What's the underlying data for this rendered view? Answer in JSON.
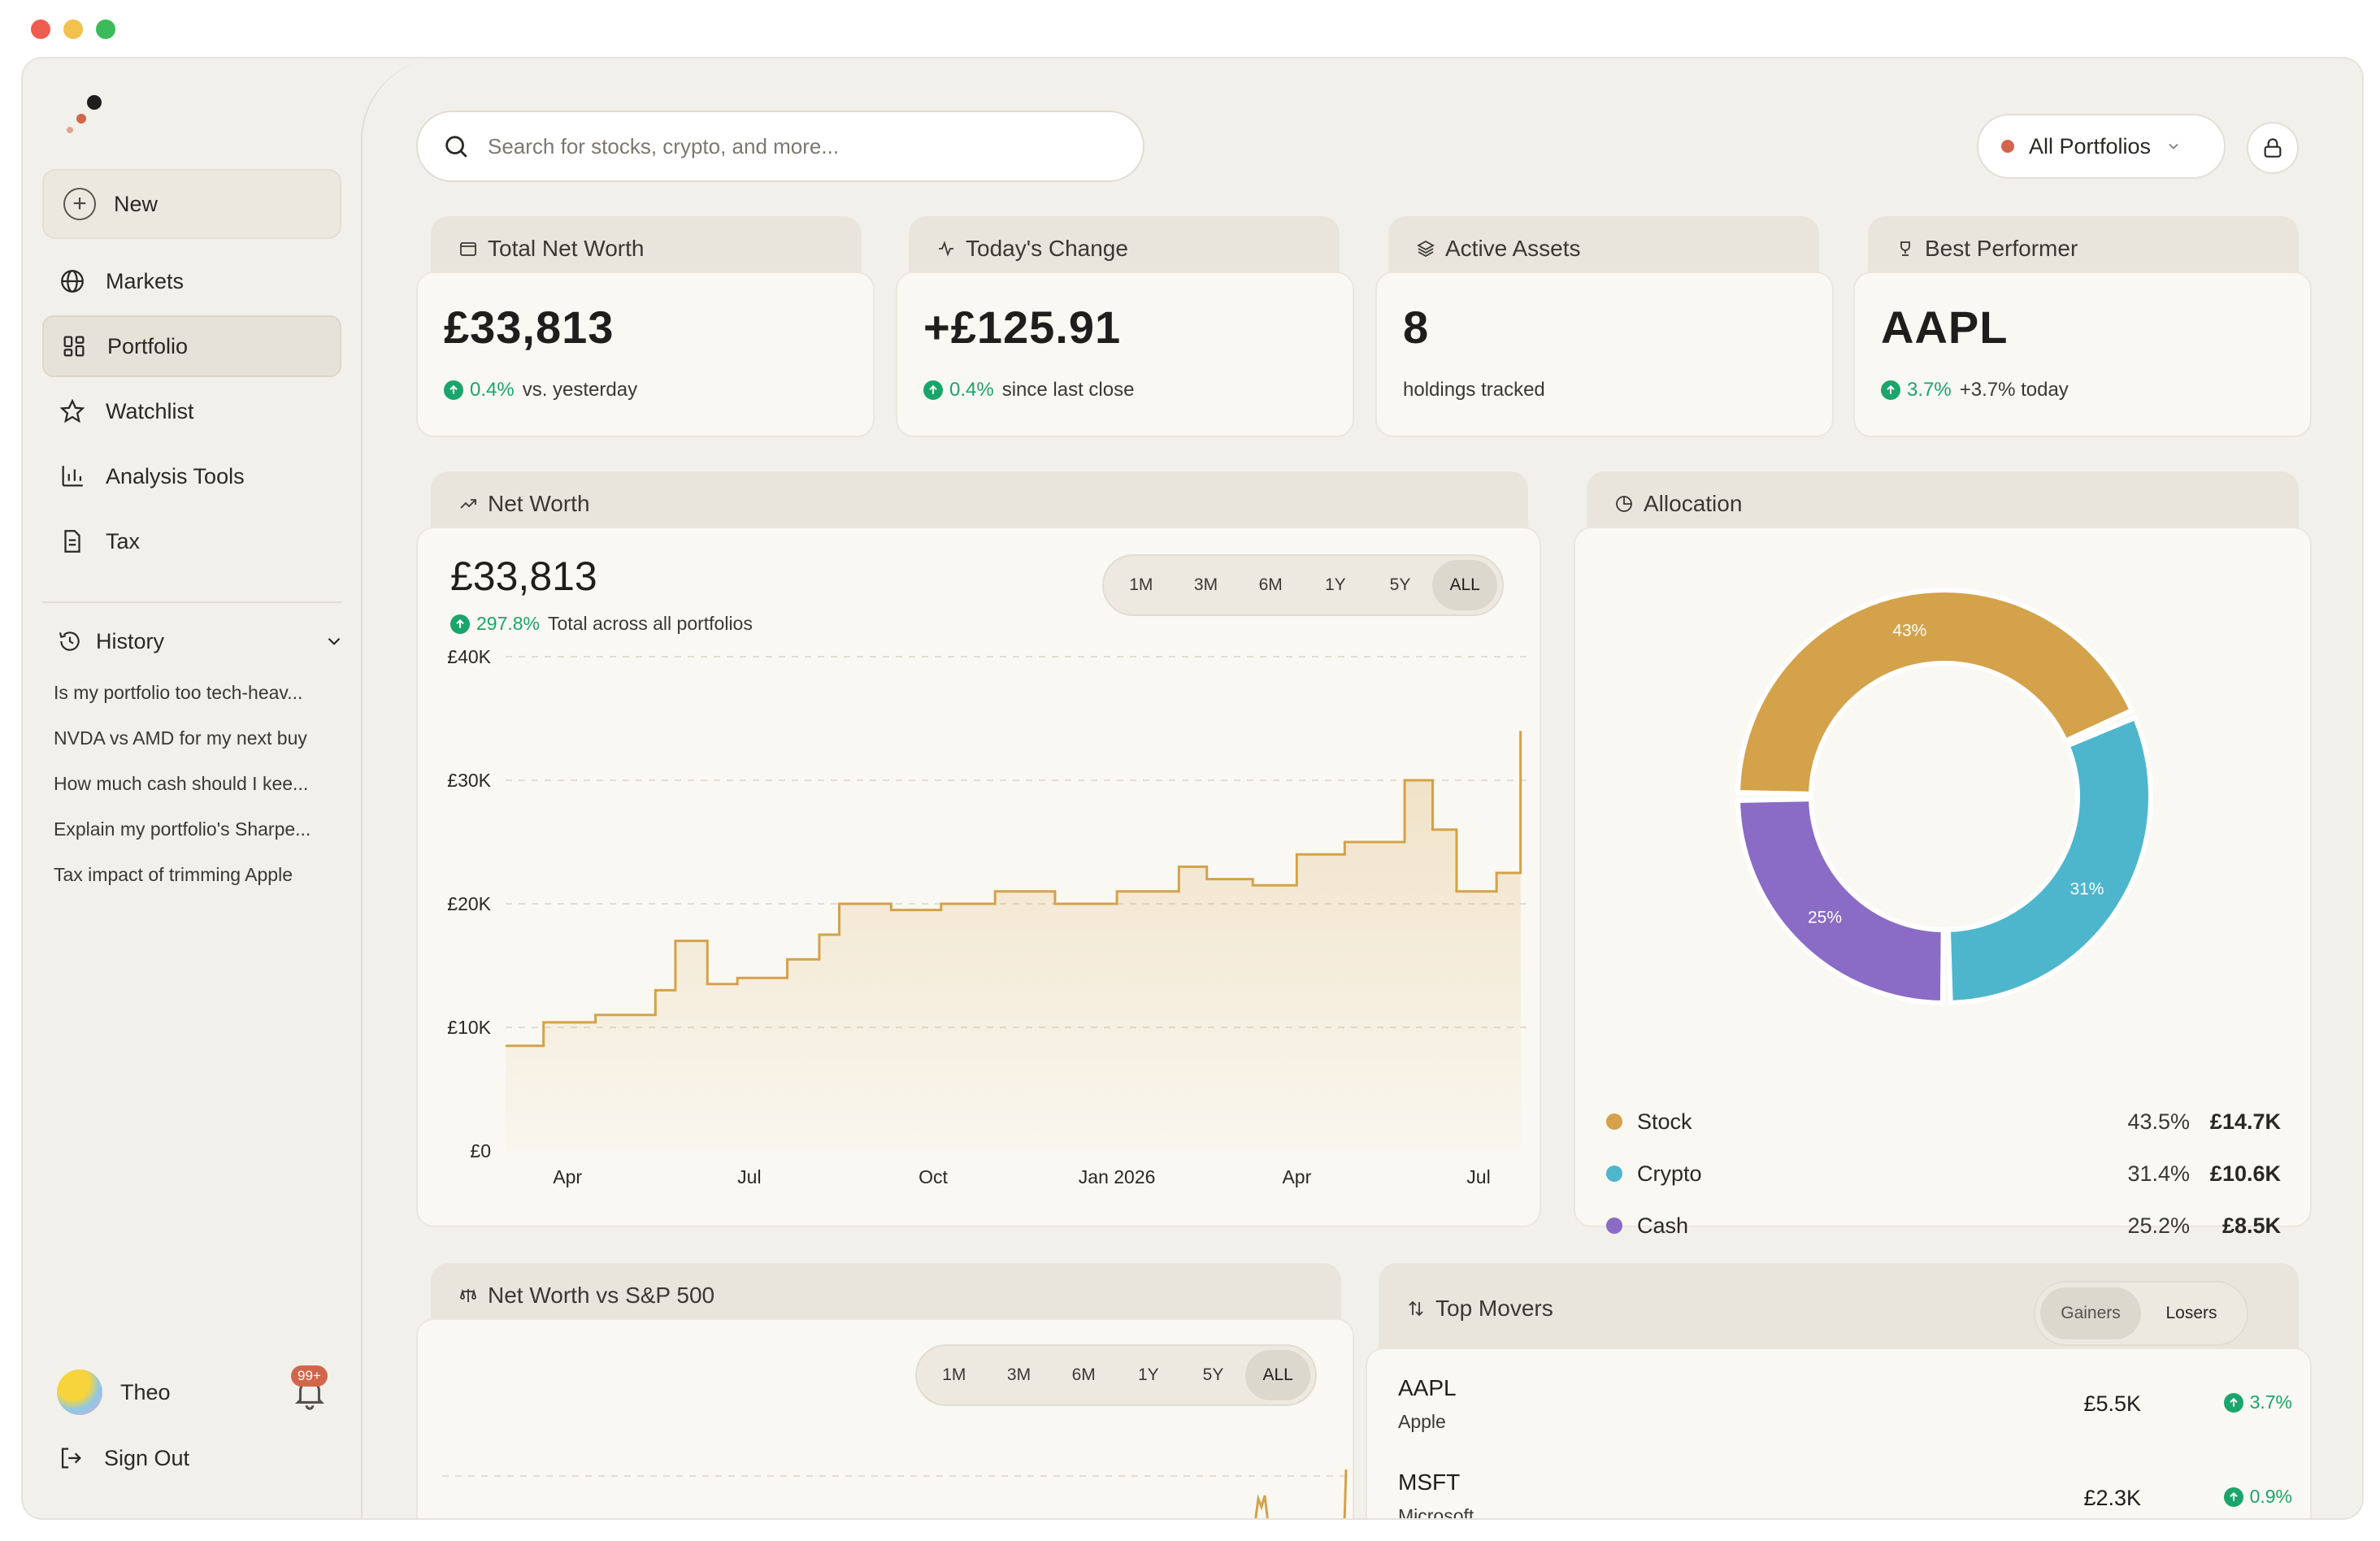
{
  "sidebar": {
    "new_label": "New",
    "nav": [
      {
        "label": "Markets",
        "icon": "globe-icon"
      },
      {
        "label": "Portfolio",
        "icon": "grid-icon",
        "active": true
      },
      {
        "label": "Watchlist",
        "icon": "star-icon"
      },
      {
        "label": "Analysis Tools",
        "icon": "bar-chart-icon"
      },
      {
        "label": "Tax",
        "icon": "document-icon"
      }
    ],
    "history_label": "History",
    "history": [
      "Is my portfolio too tech-heav...",
      "NVDA vs AMD for my next buy",
      "How much cash should I kee...",
      "Explain my portfolio's Sharpe...",
      "Tax impact of trimming Apple"
    ],
    "user_name": "Theo",
    "notifications_badge": "99+",
    "sign_out": "Sign Out"
  },
  "header": {
    "search_placeholder": "Search for stocks, crypto, and more...",
    "portfolio_select": "All Portfolios"
  },
  "stats": [
    {
      "title": "Total Net Worth",
      "icon": "wallet-icon",
      "value": "£33,813",
      "change": "0.4%",
      "suffix": "vs. yesterday"
    },
    {
      "title": "Today's Change",
      "icon": "activity-icon",
      "value": "+£125.91",
      "change": "0.4%",
      "suffix": "since last close"
    },
    {
      "title": "Active Assets",
      "icon": "layers-icon",
      "value": "8",
      "change": "",
      "suffix": "holdings tracked"
    },
    {
      "title": "Best Performer",
      "icon": "trophy-icon",
      "value": "AAPL",
      "change": "3.7%",
      "suffix": "+3.7% today"
    }
  ],
  "net_worth": {
    "title": "Net Worth",
    "value": "£33,813",
    "change": "297.8%",
    "suffix": "Total across all portfolios",
    "ranges": [
      "1M",
      "3M",
      "6M",
      "1Y",
      "5Y",
      "ALL"
    ],
    "selected_range": "ALL"
  },
  "allocation": {
    "title": "Allocation",
    "items": [
      {
        "label": "Stock",
        "pct": "43.5%",
        "amount": "£14.7K",
        "color": "#d4a24a",
        "slice_label": "43%"
      },
      {
        "label": "Crypto",
        "pct": "31.4%",
        "amount": "£10.6K",
        "color": "#4db6cc",
        "slice_label": "31%"
      },
      {
        "label": "Cash",
        "pct": "25.2%",
        "amount": "£8.5K",
        "color": "#8a6bc6",
        "slice_label": "25%"
      }
    ]
  },
  "vs_sp500": {
    "title": "Net Worth vs S&P 500",
    "ranges": [
      "1M",
      "3M",
      "6M",
      "1Y",
      "5Y",
      "ALL"
    ],
    "selected_range": "ALL"
  },
  "top_movers": {
    "title": "Top Movers",
    "tabs": [
      "Gainers",
      "Losers"
    ],
    "selected_tab": "Gainers",
    "items": [
      {
        "ticker": "AAPL",
        "name": "Apple",
        "value": "£5.5K",
        "change": "3.7%"
      },
      {
        "ticker": "MSFT",
        "name": "Microsoft",
        "value": "£2.3K",
        "change": "0.9%"
      }
    ]
  },
  "chart_data": {
    "type": "area",
    "title": "Net Worth",
    "xlabel": "",
    "ylabel": "",
    "x_ticks": [
      "Apr",
      "Jul",
      "Oct",
      "Jan 2026",
      "Apr",
      "Jul"
    ],
    "y_ticks": [
      "£40K",
      "£30K",
      "£20K",
      "£10K",
      "£0"
    ],
    "ylim": [
      0,
      40000
    ],
    "x": [
      "2025-03-01",
      "2025-03-20",
      "2025-04-15",
      "2025-05-15",
      "2025-05-25",
      "2025-06-10",
      "2025-06-25",
      "2025-07-20",
      "2025-08-05",
      "2025-08-15",
      "2025-09-10",
      "2025-10-05",
      "2025-11-01",
      "2025-12-01",
      "2026-01-01",
      "2026-02-01",
      "2026-02-15",
      "2026-03-10",
      "2026-04-01",
      "2026-04-25",
      "2026-05-25",
      "2026-06-08",
      "2026-06-20",
      "2026-07-10",
      "2026-07-22"
    ],
    "values": [
      8500,
      10400,
      11000,
      13000,
      17000,
      13500,
      14000,
      15500,
      17500,
      20000,
      19500,
      20000,
      21000,
      20000,
      21000,
      23000,
      22000,
      21500,
      24000,
      25000,
      30000,
      26000,
      21000,
      22500,
      34000
    ],
    "series": [
      {
        "name": "",
        "values": [
          8500,
          10400,
          11000,
          13000,
          17000,
          13500,
          14000,
          15500,
          17500,
          20000,
          19500,
          20000,
          21000,
          20000,
          21000,
          23000,
          22000,
          21500,
          24000,
          25000,
          30000,
          26000,
          21000,
          22500,
          34000
        ]
      }
    ],
    "grid": true,
    "color": "#d4a24a"
  }
}
